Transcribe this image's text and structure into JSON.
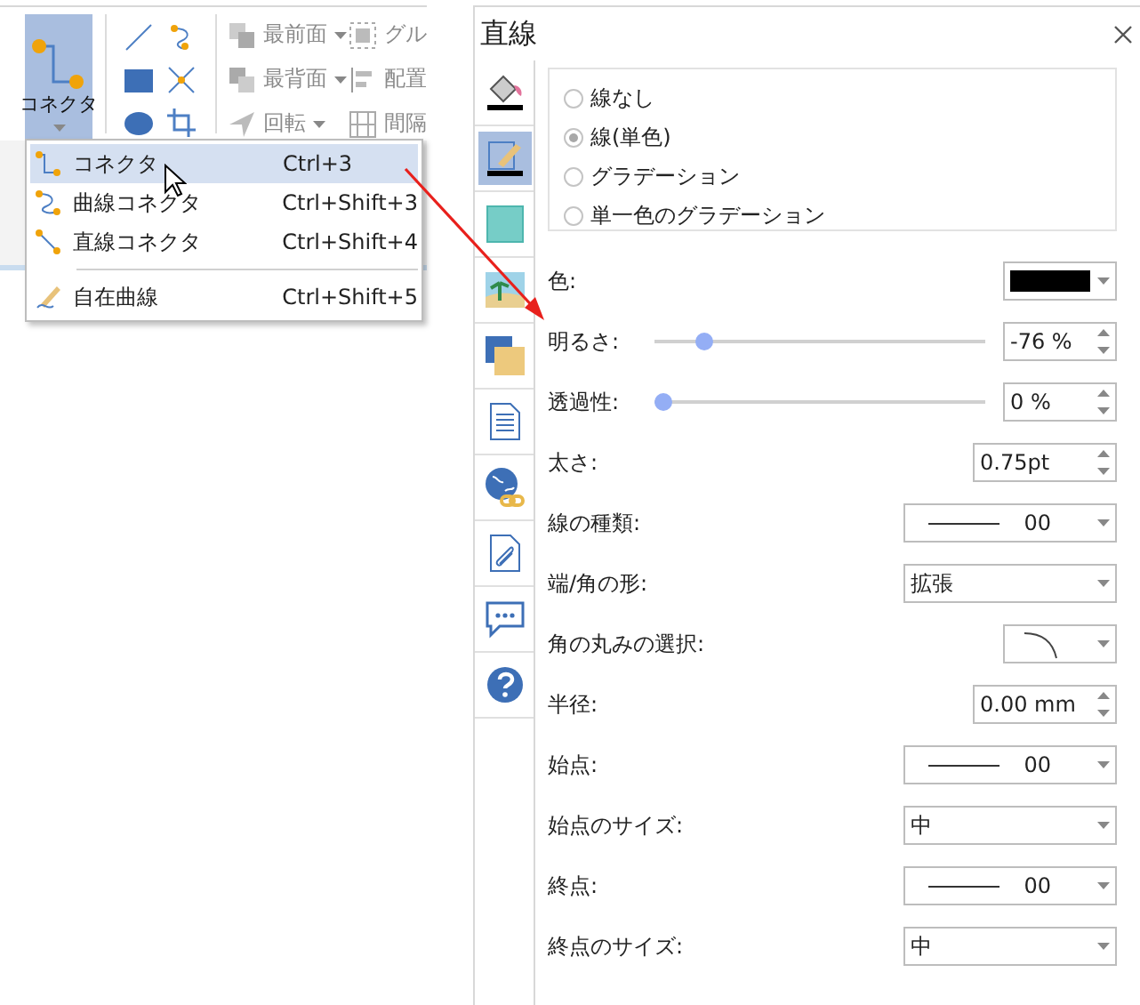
{
  "ribbon": {
    "connector_button": {
      "label": "コネクタ",
      "selected": true
    },
    "arrange_items": [
      {
        "label": "最前面",
        "disabled": true
      },
      {
        "label": "最背面",
        "disabled": true
      },
      {
        "label": "回転",
        "disabled": true
      }
    ],
    "group_items": [
      {
        "label": "グル",
        "disabled": true
      },
      {
        "label": "配置",
        "disabled": true
      },
      {
        "label": "間隔",
        "disabled": true
      }
    ]
  },
  "menu": {
    "items": [
      {
        "kind": "item",
        "label": "コネクタ",
        "shortcut": "Ctrl+3",
        "selected": true
      },
      {
        "kind": "item",
        "label": "曲線コネクタ",
        "shortcut": "Ctrl+Shift+3",
        "selected": false
      },
      {
        "kind": "item",
        "label": "直線コネクタ",
        "shortcut": "Ctrl+Shift+4",
        "selected": false
      },
      {
        "kind": "separator"
      },
      {
        "kind": "item",
        "label": "自在曲線",
        "shortcut": "Ctrl+Shift+5",
        "selected": false
      }
    ]
  },
  "panel": {
    "title": "直線",
    "tabs": [
      {
        "selected": false
      },
      {
        "selected": true
      },
      {
        "selected": false
      },
      {
        "selected": false
      },
      {
        "selected": false
      },
      {
        "selected": false
      },
      {
        "selected": false
      },
      {
        "selected": false
      },
      {
        "selected": false
      },
      {
        "selected": false
      }
    ],
    "line_options": [
      {
        "label": "線なし",
        "selected": false
      },
      {
        "label": "線(単色)",
        "selected": true
      },
      {
        "label": "グラデーション",
        "selected": false
      },
      {
        "label": "単一色のグラデーション",
        "selected": false
      }
    ],
    "properties": [
      {
        "kind": "color",
        "label": "色:",
        "color": "#000000"
      },
      {
        "kind": "slider",
        "label": "明るさ:",
        "level": 0.13,
        "value": "-76 %"
      },
      {
        "kind": "slider",
        "label": "透過性:",
        "level": 0,
        "value": "0 %"
      },
      {
        "kind": "spin",
        "label": "太さ:",
        "value": "0.75pt"
      },
      {
        "kind": "line",
        "label": "線の種類:",
        "value": "00"
      },
      {
        "kind": "select",
        "label": "端/角の形:",
        "value": "拡張"
      },
      {
        "kind": "corner",
        "label": "角の丸みの選択:"
      },
      {
        "kind": "spin",
        "label": "半径:",
        "value": "0.00 mm"
      },
      {
        "kind": "line",
        "label": "始点:",
        "value": "00"
      },
      {
        "kind": "select",
        "label": "始点のサイズ:",
        "value": "中"
      },
      {
        "kind": "line",
        "label": "終点:",
        "value": "00"
      },
      {
        "kind": "select",
        "label": "終点のサイズ:",
        "value": "中"
      }
    ]
  }
}
